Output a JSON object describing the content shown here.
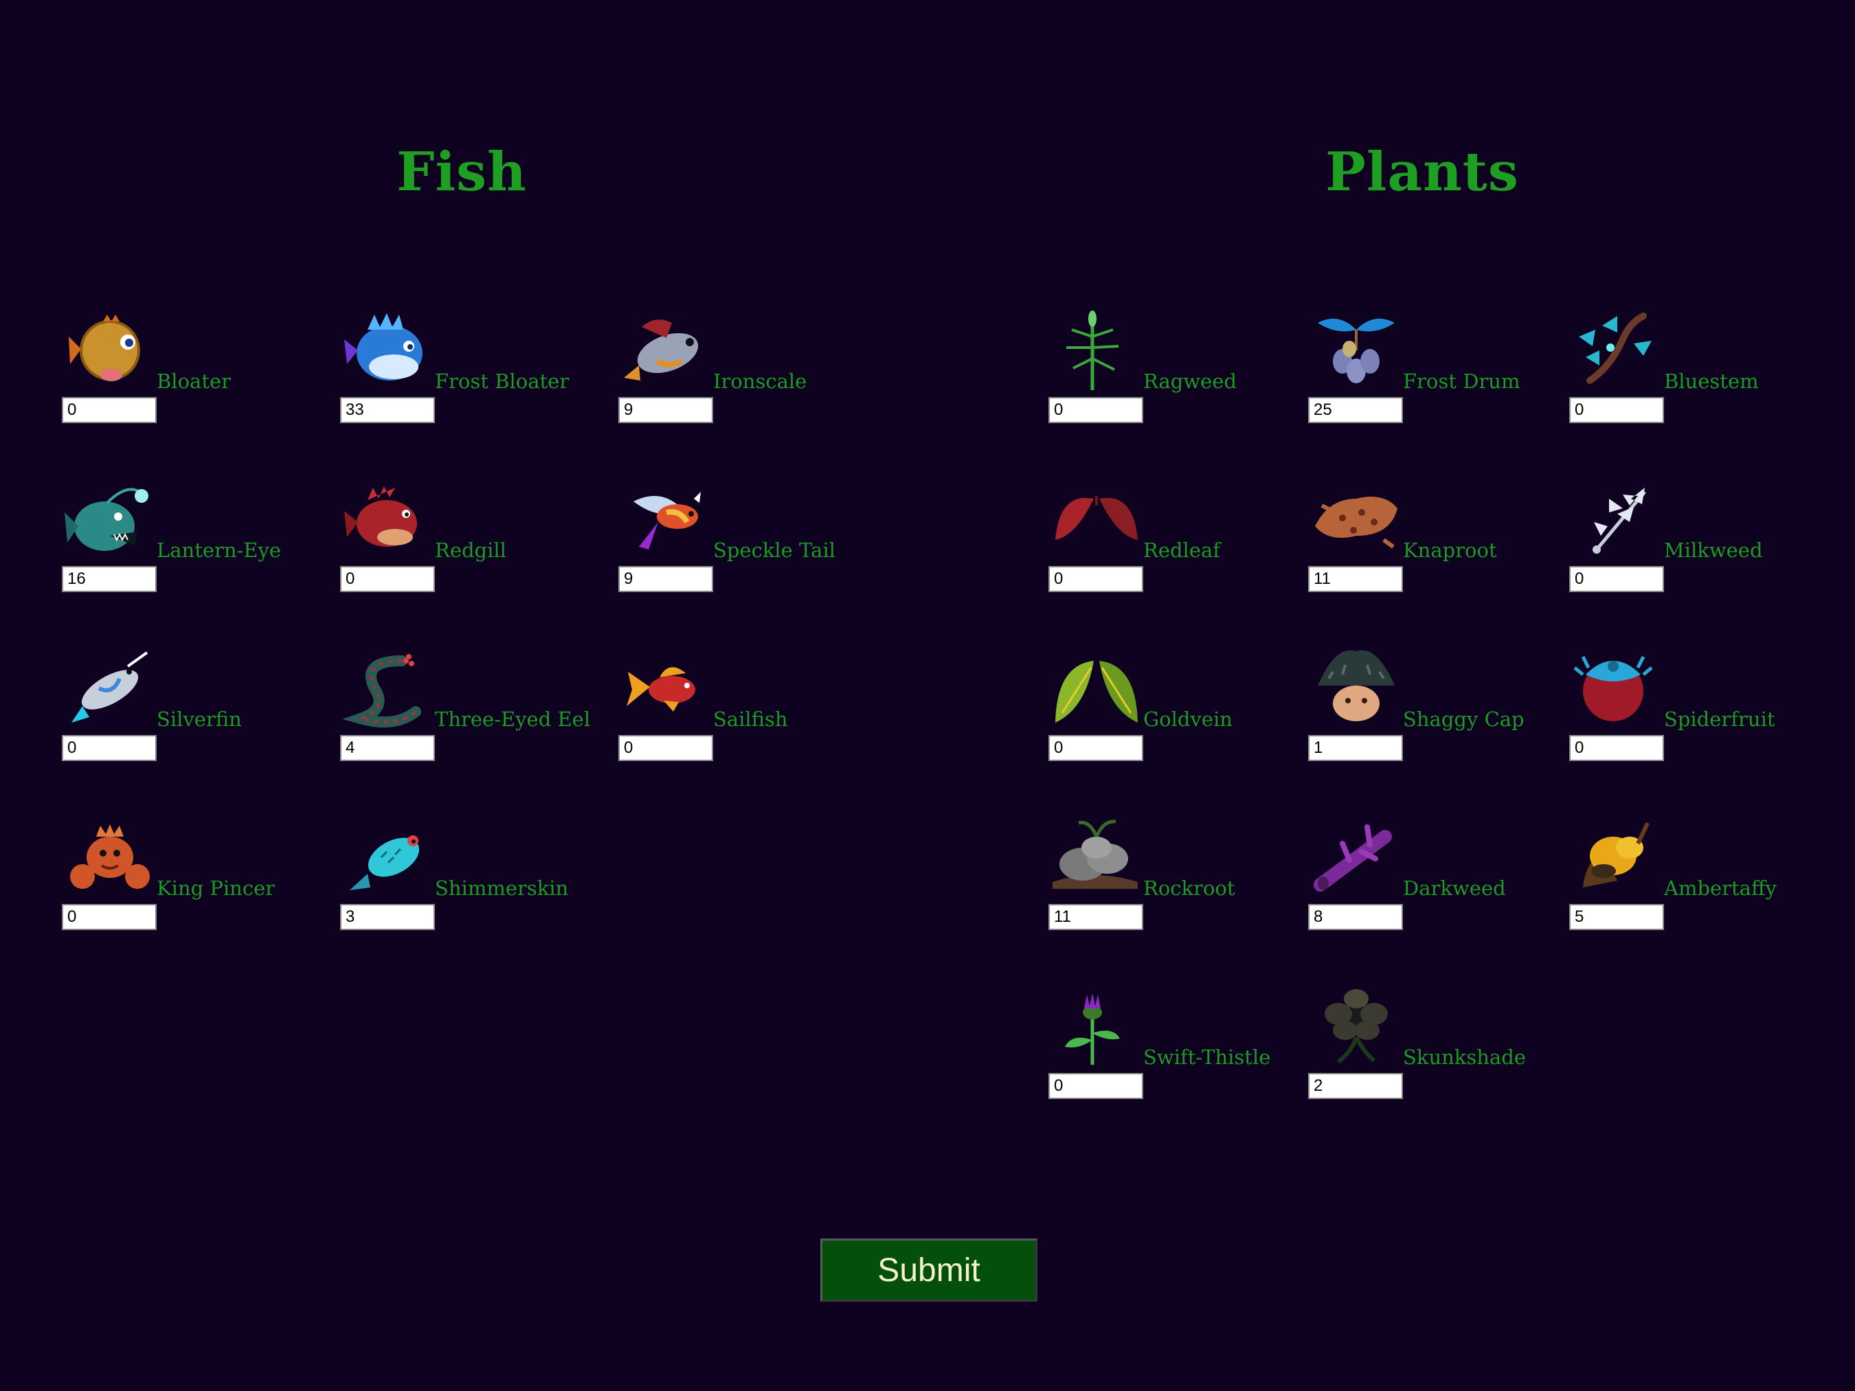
{
  "sections": {
    "fish_title": "Fish",
    "plants_title": "Plants"
  },
  "fish": [
    {
      "name": "Bloater",
      "value": "0",
      "icon": "bloater-icon"
    },
    {
      "name": "Frost Bloater",
      "value": "33",
      "icon": "frost-bloater-icon"
    },
    {
      "name": "Ironscale",
      "value": "9",
      "icon": "ironscale-icon"
    },
    {
      "name": "Lantern-Eye",
      "value": "16",
      "icon": "lantern-eye-icon"
    },
    {
      "name": "Redgill",
      "value": "0",
      "icon": "redgill-icon"
    },
    {
      "name": "Speckle Tail",
      "value": "9",
      "icon": "speckle-tail-icon"
    },
    {
      "name": "Silverfin",
      "value": "0",
      "icon": "silverfin-icon"
    },
    {
      "name": "Three-Eyed Eel",
      "value": "4",
      "icon": "three-eyed-eel-icon"
    },
    {
      "name": "Sailfish",
      "value": "0",
      "icon": "sailfish-icon"
    },
    {
      "name": "King Pincer",
      "value": "0",
      "icon": "king-pincer-icon"
    },
    {
      "name": "Shimmerskin",
      "value": "3",
      "icon": "shimmerskin-icon"
    }
  ],
  "plants": [
    {
      "name": "Ragweed",
      "value": "0",
      "icon": "ragweed-icon"
    },
    {
      "name": "Frost Drum",
      "value": "25",
      "icon": "frost-drum-icon"
    },
    {
      "name": "Bluestem",
      "value": "0",
      "icon": "bluestem-icon"
    },
    {
      "name": "Redleaf",
      "value": "0",
      "icon": "redleaf-icon"
    },
    {
      "name": "Knaproot",
      "value": "11",
      "icon": "knaproot-icon"
    },
    {
      "name": "Milkweed",
      "value": "0",
      "icon": "milkweed-icon"
    },
    {
      "name": "Goldvein",
      "value": "0",
      "icon": "goldvein-icon"
    },
    {
      "name": "Shaggy Cap",
      "value": "1",
      "icon": "shaggy-cap-icon"
    },
    {
      "name": "Spiderfruit",
      "value": "0",
      "icon": "spiderfruit-icon"
    },
    {
      "name": "Rockroot",
      "value": "11",
      "icon": "rockroot-icon"
    },
    {
      "name": "Darkweed",
      "value": "8",
      "icon": "darkweed-icon"
    },
    {
      "name": "Ambertaffy",
      "value": "5",
      "icon": "ambertaffy-icon"
    },
    {
      "name": "Swift-Thistle",
      "value": "0",
      "icon": "swift-thistle-icon"
    },
    {
      "name": "Skunkshade",
      "value": "2",
      "icon": "skunkshade-icon"
    }
  ],
  "submit_label": "Submit",
  "colors": {
    "background": "#0e0220",
    "label_green": "#1d9a22",
    "button_green": "#04500a"
  }
}
